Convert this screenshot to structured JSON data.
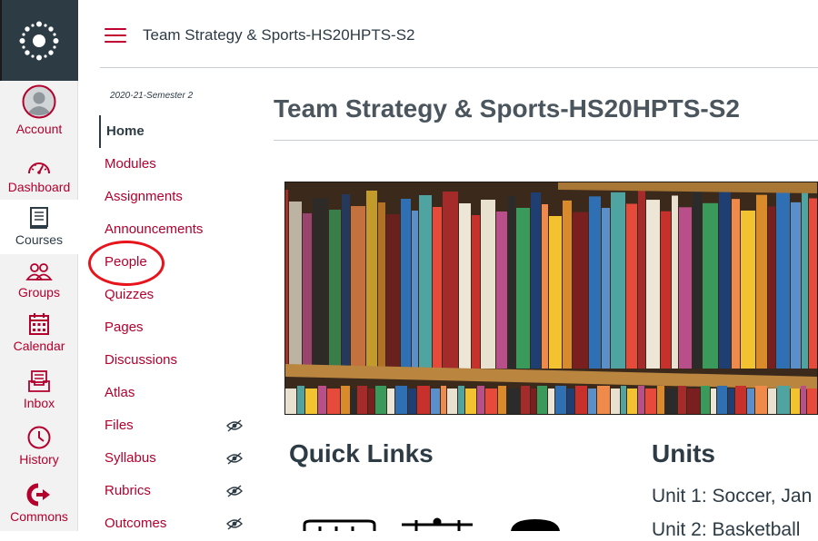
{
  "global_nav": {
    "items": [
      {
        "label": "Account",
        "icon": "avatar-icon",
        "active": false
      },
      {
        "label": "Dashboard",
        "icon": "dashboard-icon",
        "active": false
      },
      {
        "label": "Courses",
        "icon": "courses-icon",
        "active": true
      },
      {
        "label": "Groups",
        "icon": "groups-icon",
        "active": false
      },
      {
        "label": "Calendar",
        "icon": "calendar-icon",
        "active": false
      },
      {
        "label": "Inbox",
        "icon": "inbox-icon",
        "active": false
      },
      {
        "label": "History",
        "icon": "history-icon",
        "active": false
      },
      {
        "label": "Commons",
        "icon": "commons-icon",
        "active": false
      }
    ]
  },
  "header": {
    "breadcrumb": "Team Strategy & Sports-HS20HPTS-S2"
  },
  "course_nav": {
    "term": "2020-21-Semester 2",
    "items": [
      {
        "label": "Home",
        "active": true,
        "hidden": false
      },
      {
        "label": "Modules",
        "hidden": false
      },
      {
        "label": "Assignments",
        "hidden": false
      },
      {
        "label": "Announcements",
        "hidden": false
      },
      {
        "label": "People",
        "hidden": false,
        "highlighted": true
      },
      {
        "label": "Quizzes",
        "hidden": false
      },
      {
        "label": "Pages",
        "hidden": false
      },
      {
        "label": "Discussions",
        "hidden": false
      },
      {
        "label": "Atlas",
        "hidden": false
      },
      {
        "label": "Files",
        "hidden": true
      },
      {
        "label": "Syllabus",
        "hidden": true
      },
      {
        "label": "Rubrics",
        "hidden": true
      },
      {
        "label": "Outcomes",
        "hidden": true
      }
    ]
  },
  "main": {
    "title": "Team Strategy & Sports-HS20HPTS-S2",
    "quick_links_heading": "Quick Links",
    "units_heading": "Units",
    "units": [
      {
        "label": "Unit 1: Soccer, Jan"
      },
      {
        "label": "Unit 2: Basketball"
      }
    ]
  },
  "colors": {
    "brand_red": "#b3002d",
    "nav_dark": "#2d3b45",
    "annotation_circle": "#e8141b"
  }
}
